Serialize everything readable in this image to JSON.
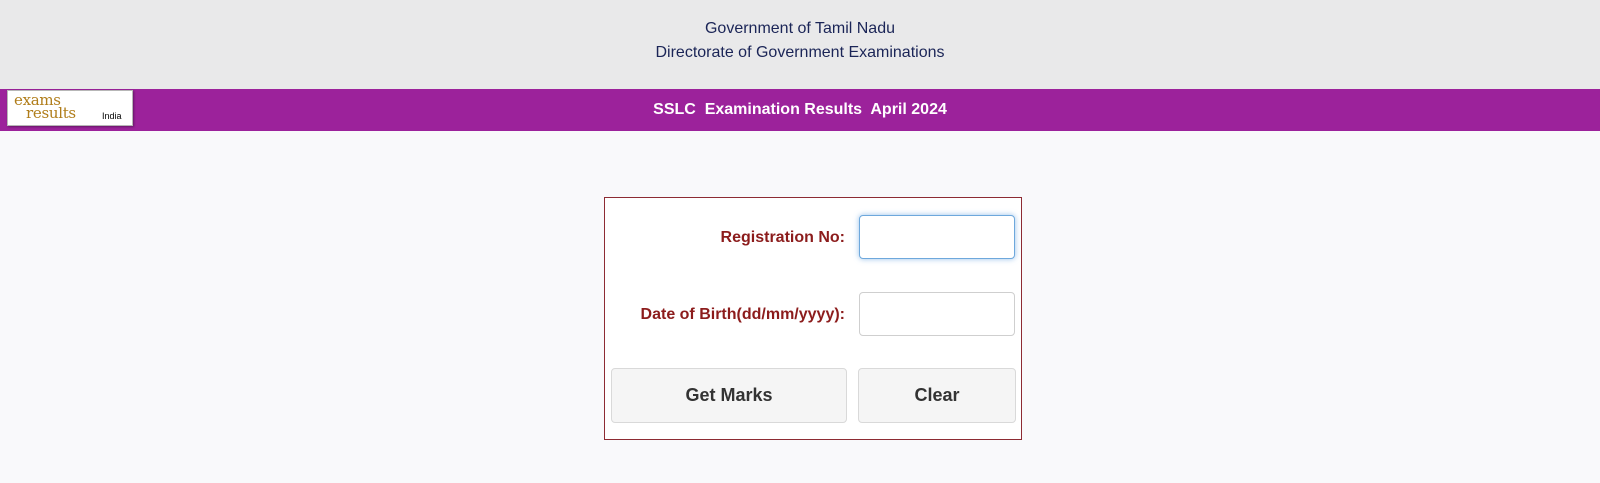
{
  "header": {
    "line1": "Government of Tamil Nadu",
    "line2": "Directorate of Government Examinations"
  },
  "logo": {
    "exams": "exams",
    "results": "results",
    "india": "India"
  },
  "banner": {
    "title": "SSLC  Examination Results  April 2024"
  },
  "form": {
    "registration_label": "Registration No:",
    "registration_value": "",
    "dob_label": "Date of Birth(dd/mm/yyyy):",
    "dob_value": "",
    "get_marks_label": "Get Marks",
    "clear_label": "Clear"
  },
  "colors": {
    "banner": "#9c229b",
    "label": "#8c1c1c",
    "header_text": "#1b2557"
  }
}
